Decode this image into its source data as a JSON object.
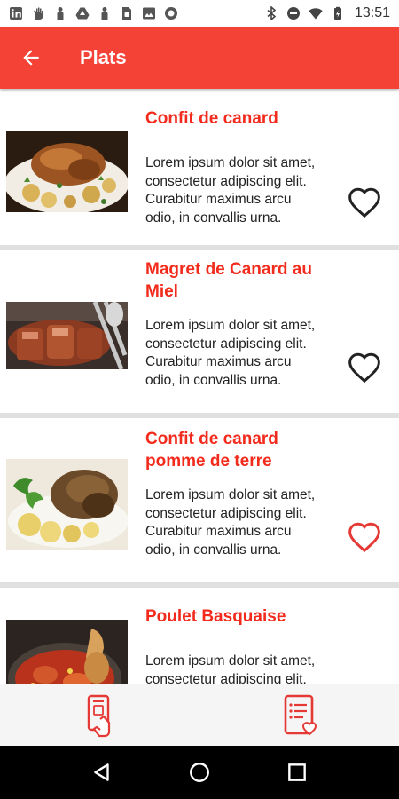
{
  "status_bar": {
    "time": "13:51",
    "left_icons": [
      "linkedin-icon",
      "hand-icon",
      "person-icon",
      "drive-icon",
      "person-icon",
      "sim-icon",
      "image-icon",
      "circle-icon"
    ],
    "right_icons": [
      "bluetooth-icon",
      "do-not-disturb-icon",
      "wifi-icon",
      "battery-icon"
    ]
  },
  "app_bar": {
    "title": "Plats",
    "back_icon": "arrow-left-icon",
    "color": "#f44336"
  },
  "colors": {
    "accent": "#f22b1d",
    "app_bar": "#f44336",
    "favorite_active": "#e53935",
    "favorite_inactive": "#222222"
  },
  "dishes": [
    {
      "title": "Confit de canard",
      "description": "Lorem ipsum dolor sit amet, consectetur adipiscing elit. Curabitur maximus arcu odio, in convallis urna.",
      "favorite": false
    },
    {
      "title": "Magret de Canard au Miel",
      "description": "Lorem ipsum dolor sit amet, consectetur adipiscing elit. Curabitur maximus arcu odio, in convallis urna.",
      "favorite": false
    },
    {
      "title": "Confit de canard pomme de terre",
      "description": "Lorem ipsum dolor sit amet, consectetur adipiscing elit. Curabitur maximus arcu odio, in convallis urna.",
      "favorite": true
    },
    {
      "title": "Poulet Basquaise",
      "description": "Lorem ipsum dolor sit amet, consectetur adipiscing elit. Curabitur maximus arcu odio, in convallis urna.",
      "favorite": false
    }
  ],
  "bottom_nav": {
    "items": [
      "phone-order-icon",
      "favorites-list-icon"
    ]
  },
  "system_nav": {
    "items": [
      "back-triangle-icon",
      "home-circle-icon",
      "recents-square-icon"
    ]
  }
}
